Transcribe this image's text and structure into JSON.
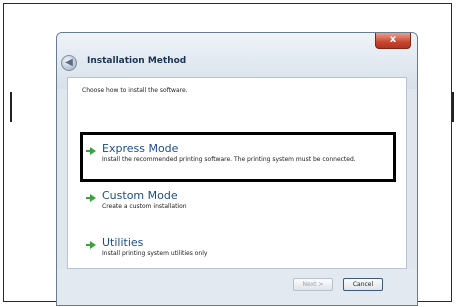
{
  "dialog": {
    "title": "Installation Method",
    "close_label": "x",
    "back_label": "◀",
    "instruction": "Choose how to install the software.",
    "options": [
      {
        "title": "Express Mode",
        "description": "Install the recommended printing software. The printing system must be connected.",
        "selected": true
      },
      {
        "title": "Custom Mode",
        "description": "Create a custom installation",
        "selected": false
      },
      {
        "title": "Utilities",
        "description": "Install printing system utilities only",
        "selected": false
      }
    ],
    "buttons": {
      "next_label": "Next >",
      "cancel_label": "Cancel",
      "next_enabled": false
    }
  },
  "colors": {
    "option_title": "#1a4e8a",
    "arrow": "#3aa33e",
    "close_button": "#c6472f",
    "highlight_border": "#000000"
  }
}
